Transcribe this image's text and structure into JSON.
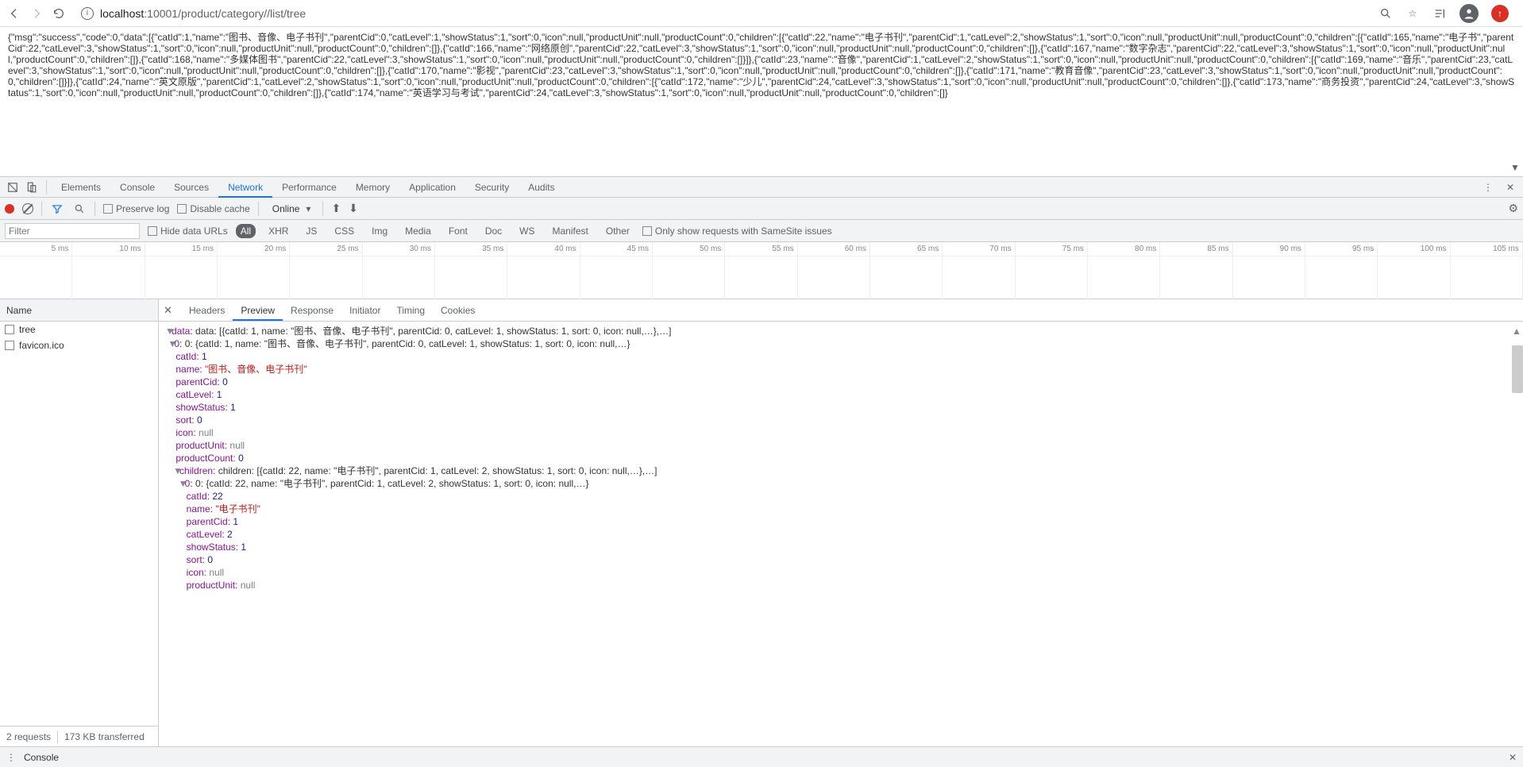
{
  "browser": {
    "url_host": "localhost",
    "url_port": ":10001",
    "url_path": "/product/category//list/tree"
  },
  "page_raw": "{\"msg\":\"success\",\"code\":0,\"data\":[{\"catId\":1,\"name\":\"图书、音像、电子书刊\",\"parentCid\":0,\"catLevel\":1,\"showStatus\":1,\"sort\":0,\"icon\":null,\"productUnit\":null,\"productCount\":0,\"children\":[{\"catId\":22,\"name\":\"电子书刊\",\"parentCid\":1,\"catLevel\":2,\"showStatus\":1,\"sort\":0,\"icon\":null,\"productUnit\":null,\"productCount\":0,\"children\":[{\"catId\":165,\"name\":\"电子书\",\"parentCid\":22,\"catLevel\":3,\"showStatus\":1,\"sort\":0,\"icon\":null,\"productUnit\":null,\"productCount\":0,\"children\":[]},{\"catId\":166,\"name\":\"网络原创\",\"parentCid\":22,\"catLevel\":3,\"showStatus\":1,\"sort\":0,\"icon\":null,\"productUnit\":null,\"productCount\":0,\"children\":[]},{\"catId\":167,\"name\":\"数字杂志\",\"parentCid\":22,\"catLevel\":3,\"showStatus\":1,\"sort\":0,\"icon\":null,\"productUnit\":null,\"productCount\":0,\"children\":[]},{\"catId\":168,\"name\":\"多媒体图书\",\"parentCid\":22,\"catLevel\":3,\"showStatus\":1,\"sort\":0,\"icon\":null,\"productUnit\":null,\"productCount\":0,\"children\":[]}]},{\"catId\":23,\"name\":\"音像\",\"parentCid\":1,\"catLevel\":2,\"showStatus\":1,\"sort\":0,\"icon\":null,\"productUnit\":null,\"productCount\":0,\"children\":[{\"catId\":169,\"name\":\"音乐\",\"parentCid\":23,\"catLevel\":3,\"showStatus\":1,\"sort\":0,\"icon\":null,\"productUnit\":null,\"productCount\":0,\"children\":[]},{\"catId\":170,\"name\":\"影视\",\"parentCid\":23,\"catLevel\":3,\"showStatus\":1,\"sort\":0,\"icon\":null,\"productUnit\":null,\"productCount\":0,\"children\":[]},{\"catId\":171,\"name\":\"教育音像\",\"parentCid\":23,\"catLevel\":3,\"showStatus\":1,\"sort\":0,\"icon\":null,\"productUnit\":null,\"productCount\":0,\"children\":[]}]},{\"catId\":24,\"name\":\"英文原版\",\"parentCid\":1,\"catLevel\":2,\"showStatus\":1,\"sort\":0,\"icon\":null,\"productUnit\":null,\"productCount\":0,\"children\":[{\"catId\":172,\"name\":\"少儿\",\"parentCid\":24,\"catLevel\":3,\"showStatus\":1,\"sort\":0,\"icon\":null,\"productUnit\":null,\"productCount\":0,\"children\":[]},{\"catId\":173,\"name\":\"商务投资\",\"parentCid\":24,\"catLevel\":3,\"showStatus\":1,\"sort\":0,\"icon\":null,\"productUnit\":null,\"productCount\":0,\"children\":[]},{\"catId\":174,\"name\":\"英语学习与考试\",\"parentCid\":24,\"catLevel\":3,\"showStatus\":1,\"sort\":0,\"icon\":null,\"productUnit\":null,\"productCount\":0,\"children\":[]}",
  "dt_tabs": [
    "Elements",
    "Console",
    "Sources",
    "Network",
    "Performance",
    "Memory",
    "Application",
    "Security",
    "Audits"
  ],
  "dt_active_tab": "Network",
  "toolbar": {
    "preserve_log": "Preserve log",
    "disable_cache": "Disable cache",
    "throttle": "Online"
  },
  "filter": {
    "placeholder": "Filter",
    "hide_data_urls": "Hide data URLs",
    "types": [
      "All",
      "XHR",
      "JS",
      "CSS",
      "Img",
      "Media",
      "Font",
      "Doc",
      "WS",
      "Manifest",
      "Other"
    ],
    "samesite": "Only show requests with SameSite issues"
  },
  "timeline_ticks": [
    "5 ms",
    "10 ms",
    "15 ms",
    "20 ms",
    "25 ms",
    "30 ms",
    "35 ms",
    "40 ms",
    "45 ms",
    "50 ms",
    "55 ms",
    "60 ms",
    "65 ms",
    "70 ms",
    "75 ms",
    "80 ms",
    "85 ms",
    "90 ms",
    "95 ms",
    "100 ms",
    "105 ms"
  ],
  "requests": {
    "header": "Name",
    "items": [
      "tree",
      "favicon.ico"
    ],
    "footer_requests": "2 requests",
    "footer_transferred": "173 KB transferred"
  },
  "detail_tabs": [
    "Headers",
    "Preview",
    "Response",
    "Initiator",
    "Timing",
    "Cookies"
  ],
  "detail_active": "Preview",
  "preview": {
    "l1": "data: [{catId: 1, name: \"图书、音像、电子书刊\", parentCid: 0, catLevel: 1, showStatus: 1, sort: 0, icon: null,…},…]",
    "l2": "0: {catId: 1, name: \"图书、音像、电子书刊\", parentCid: 0, catLevel: 1, showStatus: 1, sort: 0, icon: null,…}",
    "l3k": "catId:",
    "l3v": "1",
    "l4k": "name:",
    "l4v": "\"图书、音像、电子书刊\"",
    "l5k": "parentCid:",
    "l5v": "0",
    "l6k": "catLevel:",
    "l6v": "1",
    "l7k": "showStatus:",
    "l7v": "1",
    "l8k": "sort:",
    "l8v": "0",
    "l9k": "icon:",
    "l9v": "null",
    "l10k": "productUnit:",
    "l10v": "null",
    "l11k": "productCount:",
    "l11v": "0",
    "l12": "children: [{catId: 22, name: \"电子书刊\", parentCid: 1, catLevel: 2, showStatus: 1, sort: 0, icon: null,…},…]",
    "l13": "0: {catId: 22, name: \"电子书刊\", parentCid: 1, catLevel: 2, showStatus: 1, sort: 0, icon: null,…}",
    "l14k": "catId:",
    "l14v": "22",
    "l15k": "name:",
    "l15v": "\"电子书刊\"",
    "l16k": "parentCid:",
    "l16v": "1",
    "l17k": "catLevel:",
    "l17v": "2",
    "l18k": "showStatus:",
    "l18v": "1",
    "l19k": "sort:",
    "l19v": "0",
    "l20k": "icon:",
    "l20v": "null",
    "l21k": "productUnit:",
    "l21v": "null"
  },
  "drawer": {
    "label": "Console"
  }
}
